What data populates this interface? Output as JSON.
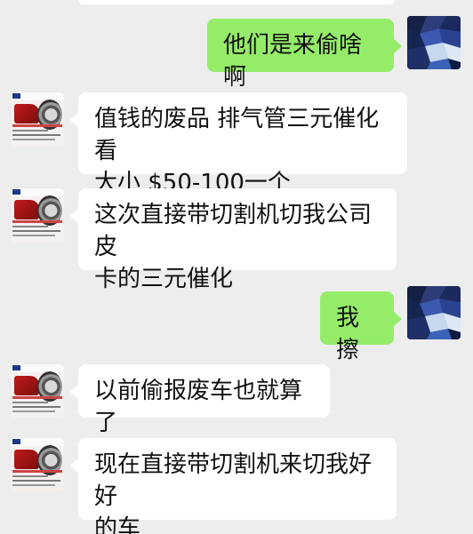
{
  "conversation": {
    "messages": [
      {
        "sender": "self",
        "text": "他们是来偷啥啊"
      },
      {
        "sender": "contact",
        "line1": "值钱的废品 排气管三元催化 看",
        "line2": "大小 $50-100一个"
      },
      {
        "sender": "contact",
        "line1": "这次直接带切割机切我公司皮",
        "line2": "卡的三元催化"
      },
      {
        "sender": "self",
        "text": "我擦"
      },
      {
        "sender": "contact",
        "text": "以前偷报废车也就算了"
      },
      {
        "sender": "contact",
        "line1": "现在直接带切割机来切我好好",
        "line2": "的车"
      }
    ]
  },
  "colors": {
    "background": "#ededed",
    "incoming_bubble": "#ffffff",
    "outgoing_bubble": "#95ec69"
  }
}
